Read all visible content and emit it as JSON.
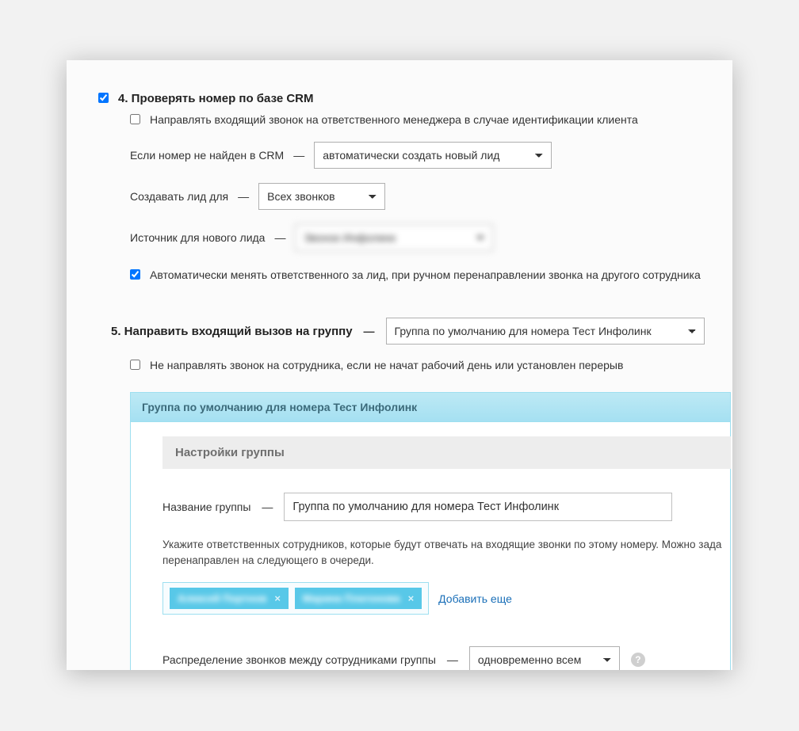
{
  "section4": {
    "title": "4. Проверять номер по базе CRM",
    "checked": true,
    "forward_to_manager": {
      "checked": false,
      "label": "Направлять входящий звонок на ответственного менеджера в случае идентификации клиента"
    },
    "not_found": {
      "label": "Если номер не найден в CRM",
      "value": "автоматически создать новый лид"
    },
    "create_lead_for": {
      "label": "Создавать лид для",
      "value": "Всех звонков"
    },
    "lead_source": {
      "label": "Источник для нового лида",
      "value": "Звонок Инфолинк"
    },
    "auto_change": {
      "checked": true,
      "label": "Автоматически менять ответственного за лид, при ручном перенаправлении звонка на другого сотрудника"
    }
  },
  "section5": {
    "title": "5. Направить входящий вызов на группу",
    "group_select": "Группа по умолчанию для номера Тест Инфолинк",
    "no_forward": {
      "checked": false,
      "label": "Не направлять звонок на сотрудника, если не начат рабочий день или установлен перерыв"
    },
    "groupbox": {
      "header": "Группа по умолчанию для номера Тест Инфолинк",
      "settings_title": "Настройки группы",
      "name_label": "Название группы",
      "name_value": "Группа по умолчанию для номера Тест Инфолинк",
      "help": "Укажите ответственных сотрудников, которые будут отвечать на входящие звонки по этому номеру. Можно зада перенаправлен на следующего в очереди.",
      "tags": [
        "Алексей Портнов",
        "Марина Платонова"
      ],
      "add_more": "Добавить еще",
      "distribution_label": "Распределение звонков между сотрудниками группы",
      "distribution_value": "одновременно всем"
    }
  }
}
